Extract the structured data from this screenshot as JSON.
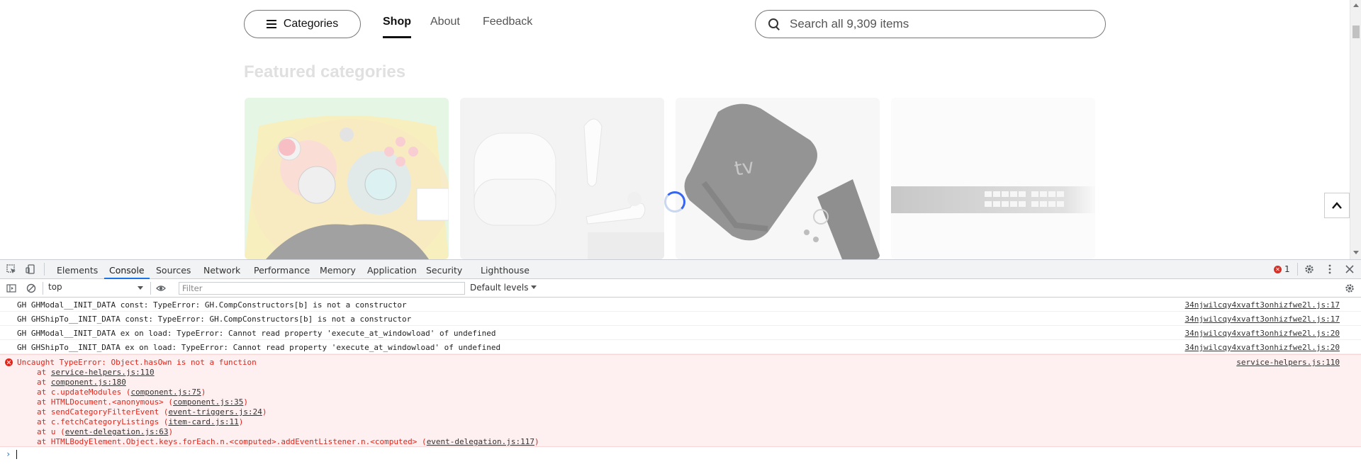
{
  "header": {
    "categories_label": "Categories",
    "nav": [
      {
        "label": "Shop",
        "active": true
      },
      {
        "label": "About",
        "active": false
      },
      {
        "label": "Feedback",
        "active": false
      }
    ],
    "search_placeholder": "Search all 9,309 items"
  },
  "main": {
    "featured_title": "Featured categories",
    "tiles": [
      {
        "name": "controller-image"
      },
      {
        "name": "airpods-image"
      },
      {
        "name": "apple-tv-image"
      },
      {
        "name": "network-switch-image"
      }
    ]
  },
  "devtools": {
    "tabs": [
      "Elements",
      "Console",
      "Sources",
      "Network",
      "Performance",
      "Memory",
      "Application",
      "Security",
      "Lighthouse"
    ],
    "active_tab": "Console",
    "error_count": "1",
    "context": "top",
    "filter_placeholder": "Filter",
    "levels_label": "Default levels",
    "logs": [
      {
        "message": "GH GHModal__INIT_DATA const: TypeError: GH.CompConstructors[b] is not a constructor",
        "source": "34njwilcqy4xvaft3onhizfwe2l.js:17"
      },
      {
        "message": "GH GHShipTo__INIT_DATA const: TypeError: GH.CompConstructors[b] is not a constructor",
        "source": "34njwilcqy4xvaft3onhizfwe2l.js:17"
      },
      {
        "message": "GH GHModal__INIT_DATA ex on load: TypeError: Cannot read property 'execute_at_windowload' of undefined",
        "source": "34njwilcqy4xvaft3onhizfwe2l.js:20"
      },
      {
        "message": "GH GHShipTo__INIT_DATA ex on load: TypeError: Cannot read property 'execute_at_windowload' of undefined",
        "source": "34njwilcqy4xvaft3onhizfwe2l.js:20"
      }
    ],
    "error": {
      "headline": "Uncaught TypeError: Object.hasOwn is not a function",
      "source": "service-helpers.js:110",
      "stack": [
        {
          "prefix": "at ",
          "link": "service-helpers.js:110",
          "suffix": ""
        },
        {
          "prefix": "at ",
          "link": "component.js:180",
          "suffix": ""
        },
        {
          "prefix": "at c.updateModules (",
          "link": "component.js:75",
          "suffix": ")"
        },
        {
          "prefix": "at HTMLDocument.<anonymous> (",
          "link": "component.js:35",
          "suffix": ")"
        },
        {
          "prefix": "at sendCategoryFilterEvent (",
          "link": "event-triggers.js:24",
          "suffix": ")"
        },
        {
          "prefix": "at c.fetchCategoryListings (",
          "link": "item-card.js:11",
          "suffix": ")"
        },
        {
          "prefix": "at u (",
          "link": "event-delegation.js:63",
          "suffix": ")"
        },
        {
          "prefix": "at HTMLBodyElement.Object.keys.forEach.n.<computed>.addEventListener.n.<computed> (",
          "link": "event-delegation.js:117",
          "suffix": ")"
        }
      ]
    }
  }
}
